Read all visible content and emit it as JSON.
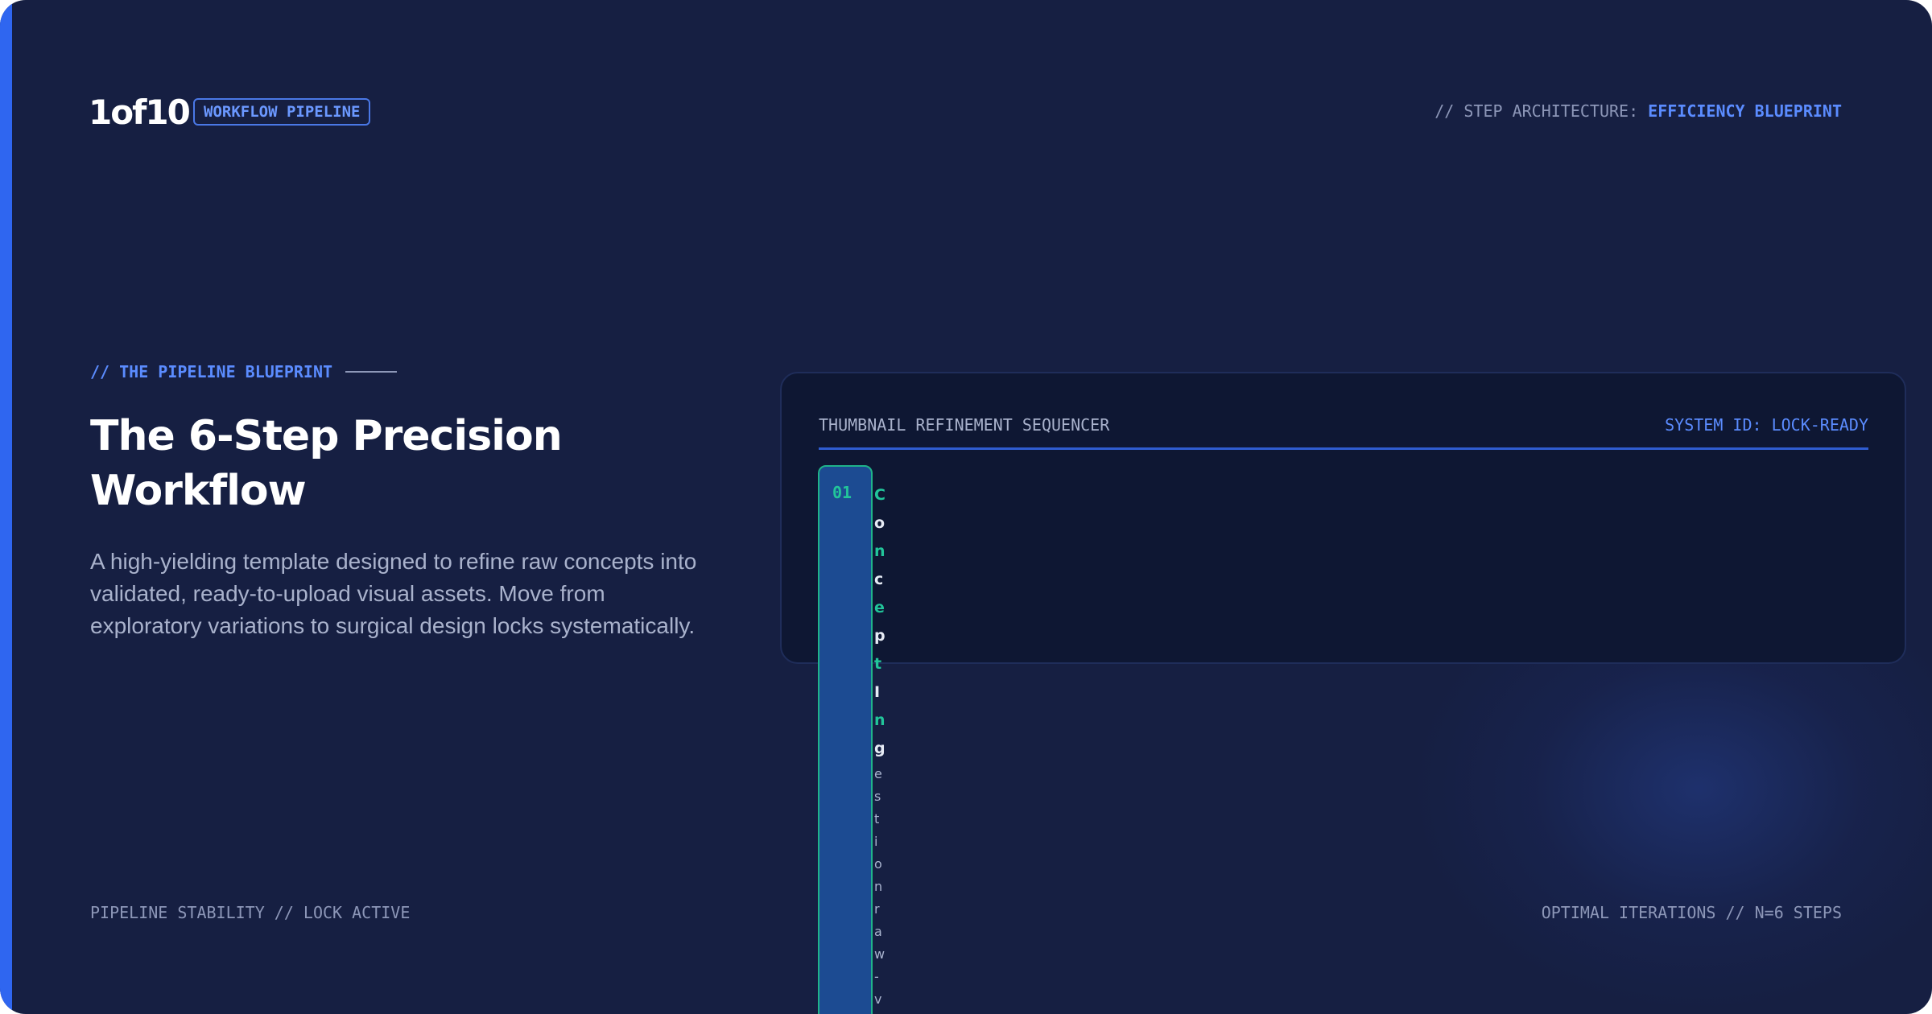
{
  "brand": {
    "logo": "1of10",
    "badge": "WORKFLOW PIPELINE"
  },
  "header": {
    "arch_prefix": "// STEP ARCHITECTURE:",
    "arch_value": "EFFICIENCY BLUEPRINT"
  },
  "hero": {
    "eyebrow": "// THE PIPELINE BLUEPRINT",
    "title": "The 6-Step Precision Workflow",
    "description": "A high-yielding template designed to refine raw concepts into validated, ready-to-upload visual assets. Move from exploratory variations to surgical design locks systematically."
  },
  "footer": {
    "left": "PIPELINE STABILITY // LOCK ACTIVE",
    "right": "OPTIMAL ITERATIONS // N=6 STEPS"
  },
  "panel": {
    "title": "THUMBNAIL REFINEMENT SEQUENCER",
    "system_id": "SYSTEM ID: LOCK-READY",
    "step_number": "01",
    "step_glyphs": [
      "C",
      "o",
      "n",
      "c",
      "e",
      "p",
      "t",
      "I",
      "n",
      "g",
      "e",
      "s",
      "t",
      "i",
      "o",
      "n",
      "r",
      "a",
      "w",
      "-",
      "v"
    ]
  },
  "colors": {
    "background": "#161f42",
    "accent": "#2f66f0",
    "highlight": "#5b8cff",
    "mint": "#22c59a",
    "panel": "#0e1733"
  }
}
